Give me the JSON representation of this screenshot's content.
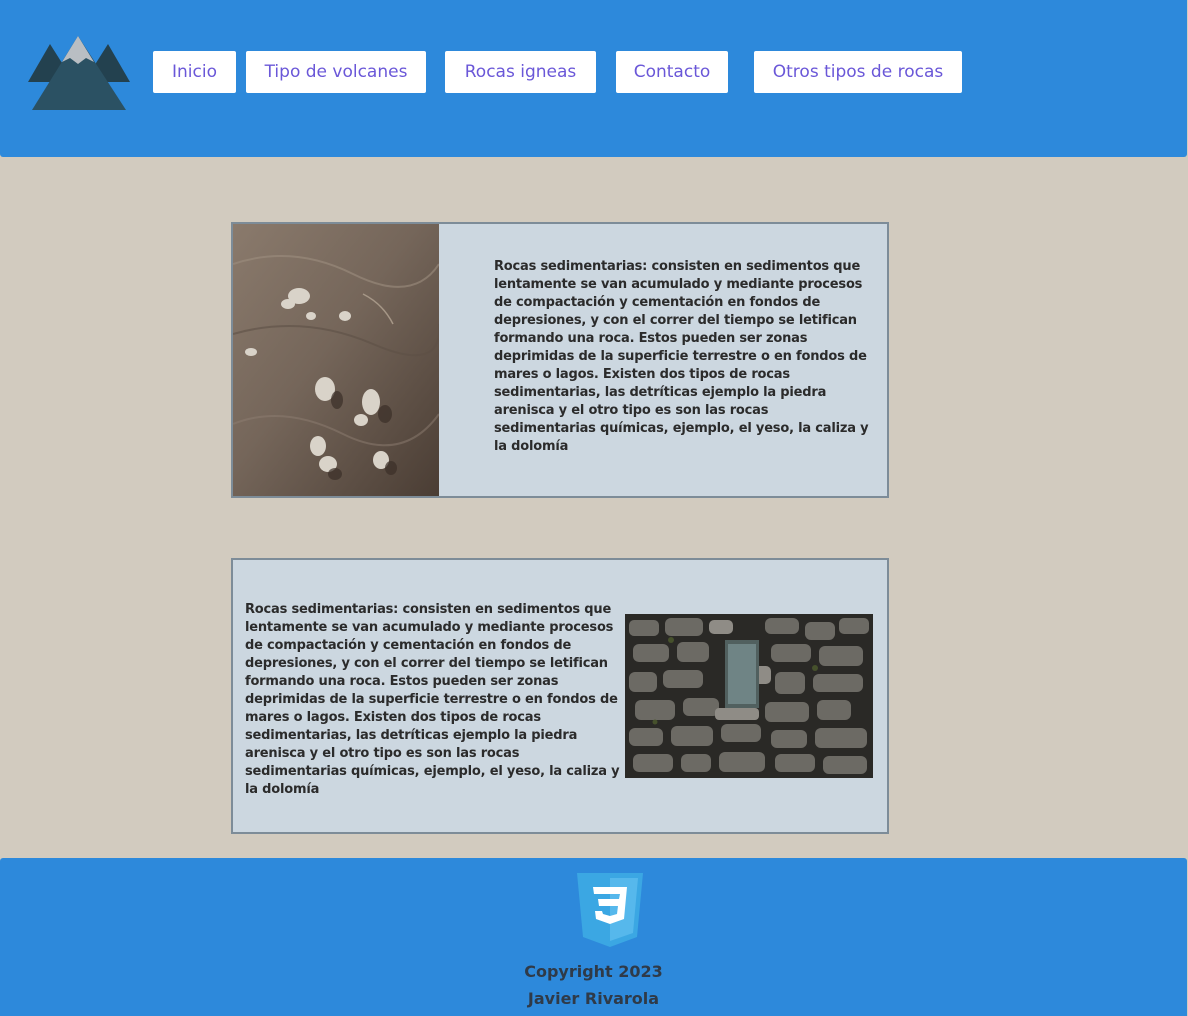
{
  "nav": {
    "items": [
      {
        "label": "Inicio"
      },
      {
        "label": "Tipo de volcanes"
      },
      {
        "label": "Rocas igneas"
      },
      {
        "label": "Contacto"
      },
      {
        "label": "Otros tipos de rocas"
      }
    ]
  },
  "cards": [
    {
      "text": "Rocas sedimentarias: consisten en sedimentos que lentamente se van acumulado y mediante procesos de compactación y cementación en fondos de depresiones, y con el correr del tiempo se letifican formando una roca. Estos pueden ser zonas deprimidas de la superficie terrestre o en fondos de mares o lagos. Existen dos tipos de rocas sedimentarias, las detríticas ejemplo la piedra arenisca y el otro tipo es son las rocas sedimentarias químicas, ejemplo, el yeso, la caliza y la dolomía"
    },
    {
      "text": "Rocas sedimentarias: consisten en sedimentos que lentamente se van acumulado y mediante procesos de compactación y cementación en fondos de depresiones, y con el correr del tiempo se letifican formando una roca. Estos pueden ser zonas deprimidas de la superficie terrestre o en fondos de mares o lagos. Existen dos tipos de rocas sedimentarias, las detríticas ejemplo la piedra arenisca y el otro tipo es son las rocas sedimentarias químicas, ejemplo, el yeso, la caliza y la dolomía"
    }
  ],
  "footer": {
    "copyright": "Copyright 2023",
    "author": "Javier Rivarola"
  },
  "colors": {
    "header_bg": "#2d89db",
    "page_bg": "#d2cbbf",
    "card_bg": "#ccd7e0",
    "nav_text": "#6a57d8"
  },
  "icons": {
    "logo": "mountain-logo-icon",
    "footer_badge": "css3-icon"
  }
}
